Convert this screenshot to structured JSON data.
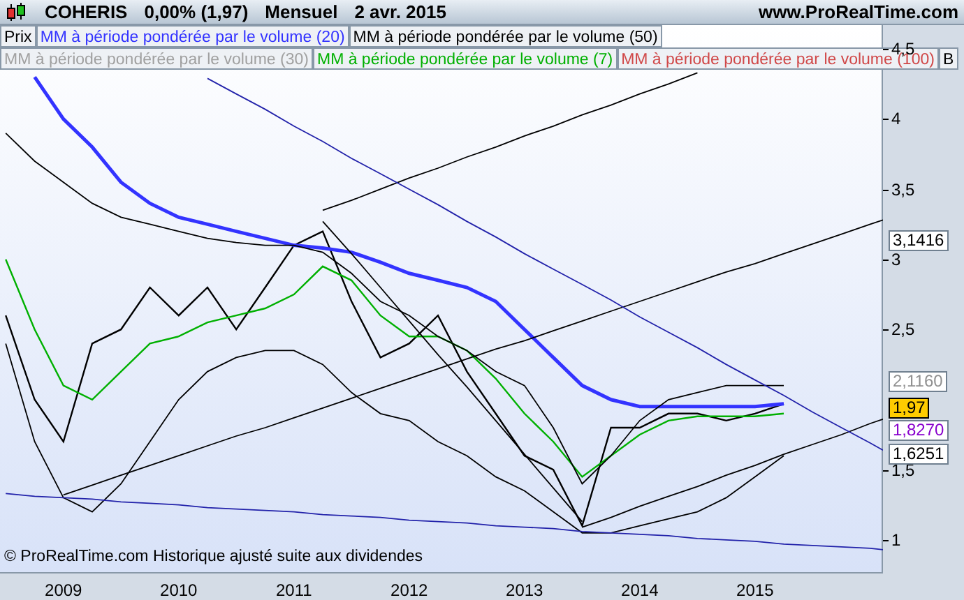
{
  "header": {
    "symbol": "COHERIS",
    "change": "0,00% (1,97)",
    "period": "Mensuel",
    "date": "2 avr. 2015",
    "site": "www.ProRealTime.com"
  },
  "legend_rows": [
    [
      {
        "kind": "series"
      },
      {
        "kind": "series"
      },
      {
        "kind": "label",
        "text": "MM à période pondérée par le volume (50)",
        "color": "#000000"
      }
    ],
    [
      {
        "kind": "label",
        "text": "MM à période pondérée par le volume (30)",
        "color": "#a0a0a0"
      },
      {
        "kind": "series"
      },
      {
        "kind": "label",
        "text": "MM à période pondérée par le volume (100)",
        "color": "#d04848"
      },
      {
        "kind": "label",
        "text": "B",
        "color": "#000000"
      }
    ]
  ],
  "footnote": "© ProRealTime.com Historique ajusté suite aux dividendes",
  "price_tags": [
    {
      "text": "3,1416",
      "color": "#000000",
      "kind": "level"
    },
    {
      "text": "2,1160",
      "color": "#909090",
      "kind": "level"
    },
    {
      "text": "1,97",
      "color": "#000000",
      "kind": "current"
    },
    {
      "text": "1,8270",
      "color": "#8800cc",
      "kind": "level"
    },
    {
      "text": "1,6251",
      "color": "#000000",
      "kind": "level"
    }
  ],
  "chart_data": {
    "type": "line",
    "x": [
      2008.5,
      2008.75,
      2009,
      2009.25,
      2009.5,
      2009.75,
      2010,
      2010.25,
      2010.5,
      2010.75,
      2011,
      2011.25,
      2011.5,
      2011.75,
      2012,
      2012.25,
      2012.5,
      2012.75,
      2013,
      2013.25,
      2013.5,
      2013.75,
      2014,
      2014.25,
      2014.5,
      2014.75,
      2015,
      2015.25,
      2015.5,
      2015.75,
      2016,
      2016.11
    ],
    "series": [
      {
        "name": "Prix",
        "color": "#000000",
        "values": [
          2.6,
          2.0,
          1.7,
          2.4,
          2.5,
          2.8,
          2.6,
          2.8,
          2.5,
          2.8,
          3.1,
          3.2,
          2.7,
          2.3,
          2.4,
          2.6,
          2.2,
          1.9,
          1.6,
          1.5,
          1.1,
          1.8,
          1.8,
          1.9,
          1.9,
          1.85,
          1.9,
          1.97,
          null,
          null,
          null,
          null
        ]
      },
      {
        "name": "MM à période pondérée par le volume (20)",
        "color": "#3333ff",
        "values": [
          null,
          4.3,
          4.0,
          3.8,
          3.55,
          3.4,
          3.3,
          3.25,
          3.2,
          3.15,
          3.1,
          3.08,
          3.05,
          2.98,
          2.9,
          2.85,
          2.8,
          2.7,
          2.5,
          2.3,
          2.1,
          2.0,
          1.95,
          1.95,
          1.95,
          1.95,
          1.95,
          1.97,
          null,
          null,
          null,
          null
        ]
      },
      {
        "name": "MM à période pondérée par le volume (7)",
        "color": "#00b000",
        "values": [
          3.0,
          2.5,
          2.1,
          2.0,
          2.2,
          2.4,
          2.45,
          2.55,
          2.6,
          2.65,
          2.75,
          2.95,
          2.85,
          2.6,
          2.45,
          2.45,
          2.35,
          2.15,
          1.9,
          1.7,
          1.45,
          1.6,
          1.75,
          1.85,
          1.88,
          1.88,
          1.88,
          1.9,
          null,
          null,
          null,
          null
        ]
      },
      {
        "color": "#000000",
        "values": [
          3.9,
          3.7,
          3.55,
          3.4,
          3.3,
          3.25,
          3.2,
          3.15,
          3.12,
          3.1,
          3.1,
          3.05,
          2.9,
          2.7,
          2.6,
          2.45,
          2.35,
          2.2,
          2.1,
          1.8,
          1.4,
          1.6,
          1.85,
          2.0,
          2.05,
          2.1,
          2.1,
          2.1,
          null,
          null,
          null,
          null
        ]
      },
      {
        "color": "#000000",
        "values": [
          2.4,
          1.7,
          1.3,
          1.2,
          1.4,
          1.7,
          2.0,
          2.2,
          2.3,
          2.35,
          2.35,
          2.25,
          2.05,
          1.9,
          1.85,
          1.7,
          1.6,
          1.45,
          1.35,
          1.2,
          1.05,
          1.05,
          1.1,
          1.15,
          1.2,
          1.3,
          1.45,
          1.6,
          null,
          null,
          null,
          null
        ]
      },
      {
        "color": "#000000",
        "values": [
          null,
          null,
          1.32,
          1.39,
          1.46,
          1.53,
          1.6,
          1.67,
          1.74,
          1.8,
          1.87,
          1.94,
          2.01,
          2.08,
          2.15,
          2.22,
          2.29,
          2.36,
          2.42,
          2.49,
          2.56,
          2.63,
          2.7,
          2.77,
          2.84,
          2.91,
          2.97,
          3.04,
          3.11,
          3.18,
          3.25,
          3.28
        ]
      },
      {
        "color": "#000000",
        "values": [
          null,
          null,
          null,
          null,
          null,
          null,
          null,
          null,
          null,
          null,
          null,
          3.27,
          3.04,
          2.8,
          2.56,
          2.32,
          2.09,
          1.85,
          1.61,
          1.37,
          1.13,
          null,
          null,
          null,
          null,
          null,
          null,
          null,
          null,
          null,
          null,
          null
        ]
      },
      {
        "color": "#000000",
        "values": [
          null,
          null,
          null,
          null,
          null,
          null,
          null,
          null,
          null,
          null,
          null,
          3.35,
          3.42,
          3.5,
          3.58,
          3.65,
          3.73,
          3.8,
          3.88,
          3.95,
          4.03,
          4.1,
          4.18,
          4.25,
          4.33,
          null,
          null,
          null,
          null,
          null,
          null,
          null
        ]
      },
      {
        "color": "#000000",
        "values": [
          null,
          null,
          null,
          null,
          null,
          null,
          null,
          null,
          null,
          null,
          null,
          null,
          null,
          null,
          null,
          null,
          null,
          null,
          null,
          null,
          1.09,
          1.16,
          1.24,
          1.31,
          1.38,
          1.46,
          1.53,
          1.61,
          1.68,
          1.75,
          1.83,
          1.86
        ]
      },
      {
        "color": "#2222aa",
        "values": [
          1.33,
          1.31,
          1.3,
          1.29,
          1.27,
          1.26,
          1.25,
          1.23,
          1.22,
          1.21,
          1.2,
          1.18,
          1.17,
          1.16,
          1.14,
          1.13,
          1.12,
          1.1,
          1.09,
          1.08,
          1.06,
          1.05,
          1.04,
          1.03,
          1.01,
          1.0,
          0.99,
          0.97,
          0.96,
          0.95,
          0.94,
          0.93
        ]
      },
      {
        "color": "#2222aa",
        "values": [
          null,
          null,
          null,
          null,
          null,
          null,
          null,
          4.29,
          4.18,
          4.07,
          3.95,
          3.84,
          3.72,
          3.61,
          3.5,
          3.39,
          3.27,
          3.16,
          3.04,
          2.93,
          2.82,
          2.71,
          2.59,
          2.48,
          2.37,
          2.25,
          2.14,
          2.03,
          1.91,
          1.8,
          1.69,
          1.64
        ]
      }
    ],
    "xticks": [
      {
        "value": 2009,
        "label": "2009"
      },
      {
        "value": 2010,
        "label": "2010"
      },
      {
        "value": 2011,
        "label": "2011"
      },
      {
        "value": 2012,
        "label": "2012"
      },
      {
        "value": 2013,
        "label": "2013"
      },
      {
        "value": 2014,
        "label": "2014"
      },
      {
        "value": 2015,
        "label": "2015"
      }
    ],
    "yticks": [
      {
        "value": 1,
        "label": "1"
      },
      {
        "value": 1.5,
        "label": "1,5"
      },
      {
        "value": 2.5,
        "label": "2,5"
      },
      {
        "value": 3,
        "label": "3"
      },
      {
        "value": 3.5,
        "label": "3,5"
      },
      {
        "value": 4,
        "label": "4"
      },
      {
        "value": 4.5,
        "label": "4,5"
      }
    ],
    "xlim": [
      2008.45,
      2016.11
    ],
    "ylim": [
      0.77,
      4.67
    ]
  }
}
